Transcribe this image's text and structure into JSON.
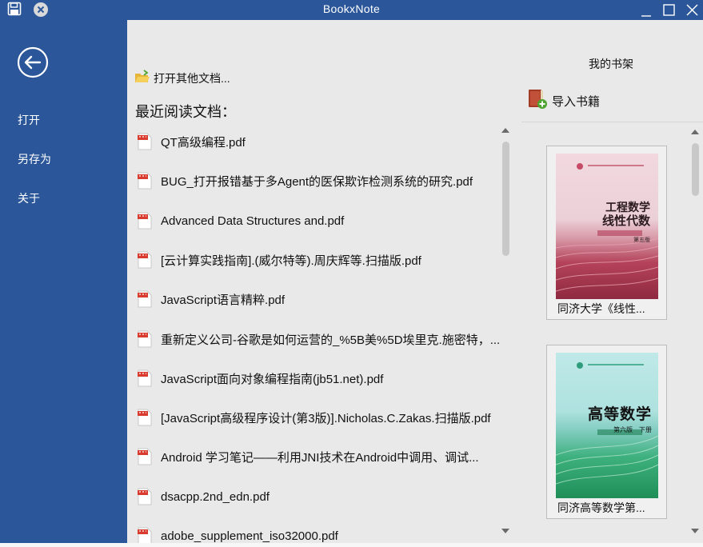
{
  "window": {
    "title": "BookxNote"
  },
  "sidebar": {
    "items": [
      "打开",
      "另存为",
      "关于"
    ]
  },
  "main": {
    "open_other": "打开其他文档...",
    "recent_title": "最近阅读文档："
  },
  "recent_docs": [
    "QT高级编程.pdf",
    "BUG_打开报错基于多Agent的医保欺诈检测系统的研究.pdf",
    "Advanced Data Structures and.pdf",
    "[云计算实践指南].(威尔特等).周庆辉等.扫描版.pdf",
    "JavaScript语言精粹.pdf",
    "重新定义公司-谷歌是如何运营的_%5B美%5D埃里克.施密特，...",
    "JavaScript面向对象编程指南(jb51.net).pdf",
    "[JavaScript高级程序设计(第3版)].Nicholas.C.Zakas.扫描版.pdf",
    "Android 学习笔记——利用JNI技术在Android中调用、调试...",
    "dsacpp.2nd_edn.pdf",
    "adobe_supplement_iso32000.pdf"
  ],
  "shelf": {
    "title": "我的书架",
    "import_label": "导入书籍",
    "books": [
      {
        "caption": "同济大学《线性...",
        "cover_title": [
          "工程数学",
          "线性代数"
        ],
        "cover_edition": "第五版"
      },
      {
        "caption": "同济高等数学第...",
        "cover_title": [
          "高等数学"
        ],
        "cover_edition": "第六版　下册"
      }
    ]
  },
  "colors": {
    "accent": "#2b579a",
    "background": "#e9e9e9",
    "pdf_red": "#d93b2f"
  }
}
